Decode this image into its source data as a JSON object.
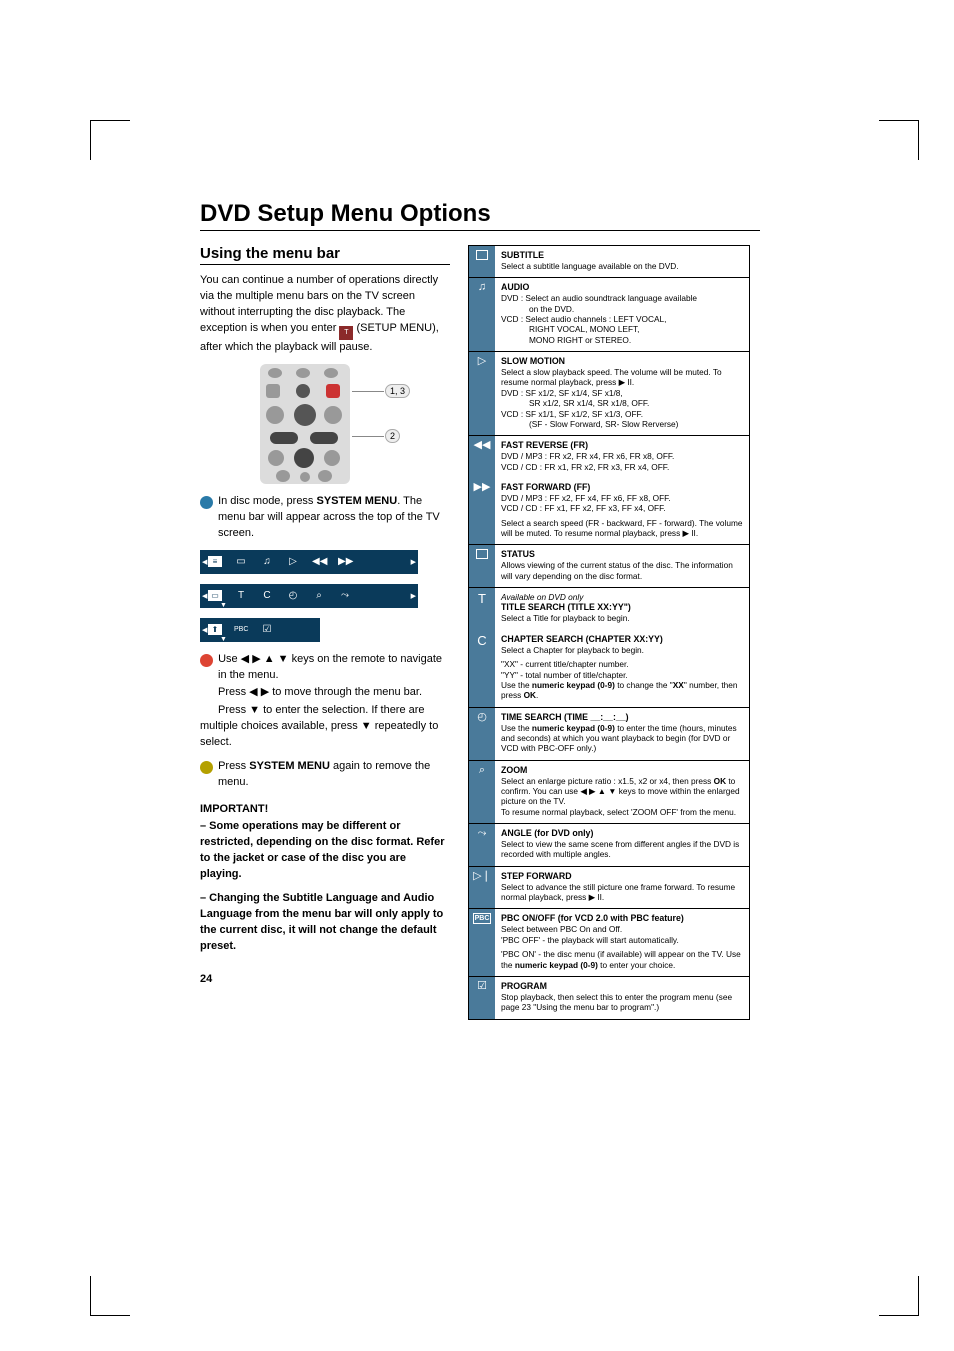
{
  "page_number": "24",
  "title": "DVD Setup Menu Options",
  "section_heading": "Using the menu bar",
  "intro": "You can continue a number of operations directly via the multiple menu bars on the TV screen without interrupting the disc playback.  The exception is when you enter",
  "intro2": "(SETUP MENU), after which the playback will pause.",
  "steps": {
    "s1a": "In disc mode, press",
    "s1b": "SYSTEM MENU",
    "s1c": ". The menu bar will appear across the top of the TV screen.",
    "s2a": "Use ◀ ▶ ▲ ▼ keys on the remote to navigate in the menu.",
    "s2b": "Press ◀ ▶ to move through the menu bar.",
    "s2c": "Press ▼ to enter the selection.  If there are multiple choices available, press ▼ repeatedly to select.",
    "s3a": "Press",
    "s3b": "SYSTEM MENU",
    "s3c": "again to remove the menu."
  },
  "important": {
    "heading": "IMPORTANT!",
    "p1": "– Some operations may be different or restricted, depending on the disc format. Refer to the jacket or case of the disc you are playing.",
    "p2": "– Changing the Subtitle Language and Audio Language from the menu bar will only apply to the current disc, it will not change the default preset."
  },
  "callouts": {
    "a": "1",
    "b": "2",
    "c": "3",
    "ac": "1, 3"
  },
  "barIcons": {
    "row1": [
      "≡",
      "▭",
      "♫",
      "▷",
      "◀◀",
      "▶▶"
    ],
    "row2": [
      "▭",
      "T",
      "C",
      "◴",
      "⌕",
      "⤳"
    ],
    "row3": [
      "⬆",
      "PBC",
      "☑"
    ]
  },
  "table": [
    {
      "icon": "subtitle",
      "glyph": "▭",
      "hd": "SUBTITLE",
      "body": [
        "Select a subtitle language available on the DVD."
      ]
    },
    {
      "icon": "audio",
      "glyph": "♫",
      "hd": "AUDIO",
      "body": [
        "DVD : Select an audio soundtrack language available",
        {
          "sub": "on the DVD."
        },
        "VCD : Select audio channels : LEFT VOCAL,",
        {
          "sub": "RIGHT VOCAL, MONO LEFT,"
        },
        {
          "sub": "MONO RIGHT or STEREO."
        }
      ]
    },
    {
      "icon": "slow",
      "glyph": "▷",
      "hd": "SLOW MOTION",
      "body": [
        "Select a slow playback speed. The volume will be muted.  To resume normal playback, press  ▶ II.",
        "DVD : SF x1/2, SF x1/4, SF x1/8,",
        {
          "sub": "SR x1/2, SR x1/4, SR x1/8, OFF."
        },
        "VCD : SF x1/1, SF x1/2, SF x1/3, OFF.",
        {
          "sub": "(SF - Slow Forward, SR- Slow Rerverse)"
        }
      ]
    },
    {
      "icon": "fr",
      "glyph": "◀◀",
      "hd": "FAST REVERSE (FR)",
      "body": [
        "DVD / MP3 : FR x2, FR x4, FR x6, FR x8, OFF.",
        "VCD / CD : FR x1, FR x2, FR x3, FR x4, OFF."
      ],
      "joinNext": true
    },
    {
      "icon": "ff",
      "glyph": "▶▶",
      "noTopBorder": true,
      "hd": "FAST FORWARD (FF)",
      "body": [
        "DVD / MP3 : FF x2, FF x4, FF x6, FF x8, OFF.",
        "VCD / CD : FF x1, FF x2, FF x3, FF x4, OFF.",
        {
          "p": "Select a search speed (FR - backward, FF - forward). The volume will be muted.  To resume normal playback, press  ▶ II."
        }
      ]
    },
    {
      "icon": "status",
      "glyph": "▭",
      "hd": "STATUS",
      "body": [
        "Allows viewing of the current status of the disc. The information will vary depending on the disc format."
      ]
    },
    {
      "icon": "title",
      "glyph": "T",
      "pre": {
        "it": "Available on DVD only"
      },
      "hd": "TITLE SEARCH (TITLE XX:YY\")",
      "body": [
        "Select a Title for playback to begin."
      ],
      "joinNext": true
    },
    {
      "icon": "chapter",
      "glyph": "C",
      "noTopBorder": true,
      "hd": "CHAPTER SEARCH (CHAPTER XX:YY)",
      "body": [
        "Select a Chapter for playback to begin.",
        {
          "p": "\"XX\" - current title/chapter number."
        },
        "\"YY\" - total number of title/chapter.",
        "Use the numeric keypad (0-9) to change the \"XX\" number, then press OK."
      ]
    },
    {
      "icon": "time",
      "glyph": "◴",
      "hd": "TIME SEARCH (TIME __:__:__)",
      "body": [
        "Use the numeric keypad (0-9) to enter the time (hours, minutes and seconds) at which you want playback to begin (for DVD or VCD with PBC-OFF only.)"
      ]
    },
    {
      "icon": "zoom",
      "glyph": "⌕",
      "hd": "ZOOM",
      "body": [
        "Select an enlarge picture ratio : x1.5, x2 or x4, then press OK to confirm.  You can use ◀ ▶ ▲ ▼ keys to move within the enlarged picture on the TV.",
        "To resume normal playback, select 'ZOOM OFF' from the menu."
      ]
    },
    {
      "icon": "angle",
      "glyph": "⤳",
      "hd": "ANGLE (for DVD only)",
      "body": [
        "Select to view the same scene from different angles if the DVD is recorded with multiple angles."
      ]
    },
    {
      "icon": "step",
      "glyph": "▷❘",
      "hd": "STEP FORWARD",
      "body": [
        "Select to advance the still picture one frame forward. To resume normal playback, press  ▶ II."
      ]
    },
    {
      "icon": "pbc",
      "glyph": "PBC",
      "hd": "PBC ON/OFF (for VCD 2.0 with PBC feature)",
      "body": [
        "Select between PBC On and Off.",
        "'PBC OFF' - the playback will start automatically.",
        {
          "p": "'PBC ON' - the disc menu (if available) will appear on the TV. Use the numeric keypad (0-9) to enter your choice."
        }
      ]
    },
    {
      "icon": "program",
      "glyph": "☑",
      "hd": "PROGRAM",
      "body": [
        "Stop playback, then select this to enter the program menu (see page 23 \"Using the menu bar to program\".)"
      ]
    }
  ]
}
